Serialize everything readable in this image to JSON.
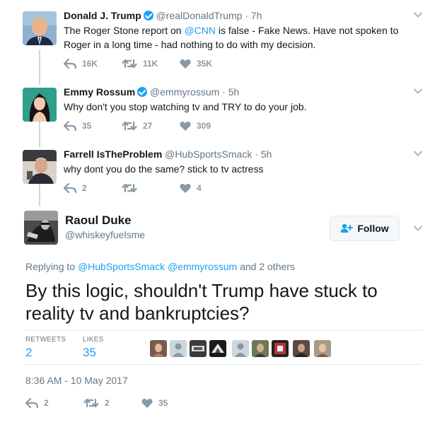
{
  "thread": [
    {
      "name": "Donald J. Trump",
      "verified": true,
      "handle": "@realDonaldTrump",
      "time": "· 7h",
      "text_before": "The Roger Stone report on ",
      "mention": "@CNN",
      "text_after": " is false - Fake News. Have not spoken to Roger in a long time - had nothing to do with my decision.",
      "replies": "16K",
      "retweets": "11K",
      "likes": "35K"
    },
    {
      "name": "Emmy Rossum",
      "verified": true,
      "handle": "@emmyrossum",
      "time": "· 5h",
      "text": "Why don't you stop watching tv and TRY to do your job.",
      "replies": "35",
      "retweets": "27",
      "likes": "309"
    },
    {
      "name": "Farrell IsTheProblem",
      "verified": false,
      "handle": "@HubSportsSmack",
      "time": "· 5h",
      "text": "why dont you do the same?  stick to tv actress",
      "replies": "2",
      "retweets": "",
      "likes": "4"
    }
  ],
  "main": {
    "name": "Raoul Duke",
    "handle": "@whiskeyfuelsme",
    "follow_label": "Follow",
    "replying_prefix": "Replying to ",
    "replying_mentions": "@HubSportsSmack @emmyrossum",
    "replying_suffix": " and 2 others",
    "text": "By this logic, shouldn't Trump have stuck to reality tv and bankruptcies?",
    "retweets_label": "RETWEETS",
    "retweets_value": "2",
    "likes_label": "LIKES",
    "likes_value": "35",
    "timestamp": "8:36 AM - 10 May 2017",
    "replies": "2",
    "retweets": "2",
    "likes": "35"
  },
  "colors": {
    "accent": "#1da1f2",
    "muted": "#657786",
    "action": "#8899a6"
  }
}
